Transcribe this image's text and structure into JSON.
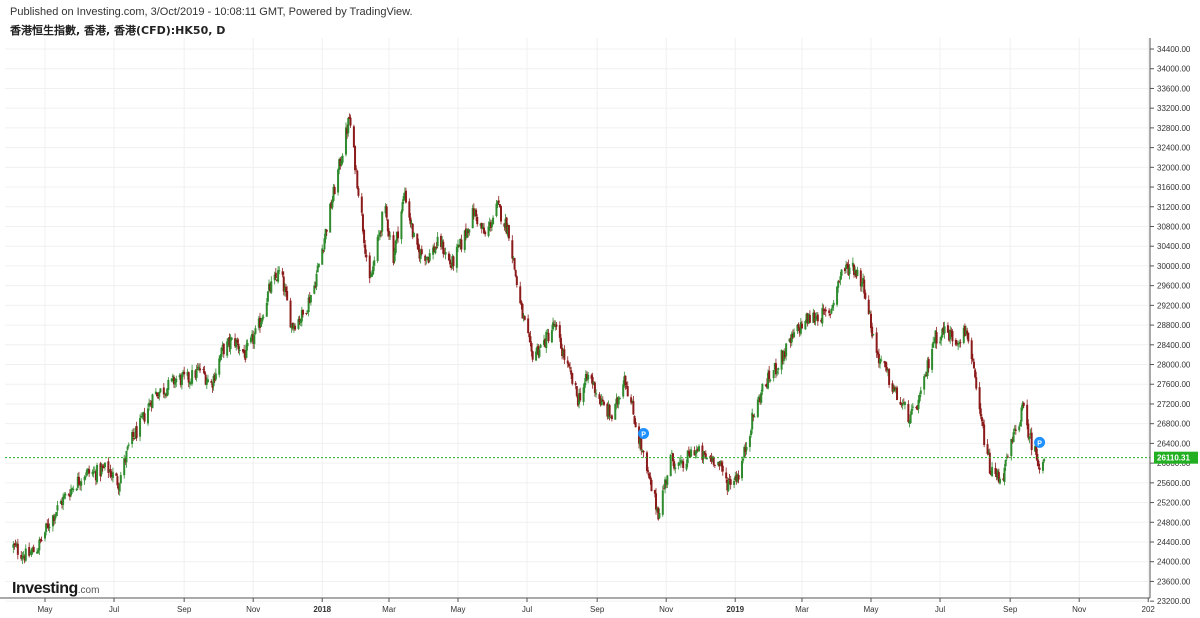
{
  "header": {
    "published": "Published on Investing.com, 3/Oct/2019 - 10:08:11 GMT, Powered by TradingView.",
    "symbol": "香港恒生指數, 香港, 香港(CFD):HK50, D"
  },
  "logo": {
    "name": "Investing",
    "suffix": ".com"
  },
  "colors": {
    "up": "#2e8b2e",
    "down": "#8b1a1a",
    "grid": "#f0f0f0",
    "last_price": "#22b022",
    "marker": "#1e90ff"
  },
  "chart_data": {
    "type": "candlestick",
    "title": "",
    "xlabel": "",
    "ylabel": "",
    "grid": true,
    "ylim": [
      23200,
      34600
    ],
    "y_ticks": [
      "34400.00",
      "34000.00",
      "33600.00",
      "33200.00",
      "32800.00",
      "32400.00",
      "32000.00",
      "31600.00",
      "31200.00",
      "30800.00",
      "30400.00",
      "30000.00",
      "29600.00",
      "29200.00",
      "28800.00",
      "28400.00",
      "28000.00",
      "27600.00",
      "27200.00",
      "26800.00",
      "26400.00",
      "26000.00",
      "25600.00",
      "25200.00",
      "24800.00",
      "24400.00",
      "24000.00",
      "23600.00",
      "23200.00"
    ],
    "x_ticks": [
      "May",
      "Jul",
      "Sep",
      "Nov",
      "2018",
      "Mar",
      "May",
      "Jul",
      "Sep",
      "Nov",
      "2019",
      "Mar",
      "May",
      "Jul",
      "Sep",
      "Nov",
      "202"
    ],
    "last_price": "26110.31",
    "markers": [
      {
        "label": "P",
        "date": "2018-10-12",
        "value": 26600
      },
      {
        "label": "P",
        "date": "2019-09-27",
        "value": 26420
      }
    ],
    "series": [
      {
        "values": [
          {
            "date": "2017-04-03",
            "value": 24300
          },
          {
            "date": "2017-04-15",
            "value": 24100
          },
          {
            "date": "2017-04-25",
            "value": 24300
          },
          {
            "date": "2017-05-05",
            "value": 24800
          },
          {
            "date": "2017-05-15",
            "value": 25200
          },
          {
            "date": "2017-05-25",
            "value": 25500
          },
          {
            "date": "2017-06-05",
            "value": 25800
          },
          {
            "date": "2017-06-15",
            "value": 25800
          },
          {
            "date": "2017-06-25",
            "value": 25900
          },
          {
            "date": "2017-07-05",
            "value": 25600
          },
          {
            "date": "2017-07-15",
            "value": 26400
          },
          {
            "date": "2017-07-25",
            "value": 26800
          },
          {
            "date": "2017-08-05",
            "value": 27400
          },
          {
            "date": "2017-08-15",
            "value": 27500
          },
          {
            "date": "2017-08-25",
            "value": 27700
          },
          {
            "date": "2017-09-05",
            "value": 27700
          },
          {
            "date": "2017-09-15",
            "value": 27900
          },
          {
            "date": "2017-09-25",
            "value": 27600
          },
          {
            "date": "2017-10-05",
            "value": 28300
          },
          {
            "date": "2017-10-15",
            "value": 28500
          },
          {
            "date": "2017-10-25",
            "value": 28200
          },
          {
            "date": "2017-11-05",
            "value": 28700
          },
          {
            "date": "2017-11-15",
            "value": 29500
          },
          {
            "date": "2017-11-25",
            "value": 29900
          },
          {
            "date": "2017-12-05",
            "value": 28800
          },
          {
            "date": "2017-12-15",
            "value": 29000
          },
          {
            "date": "2017-12-25",
            "value": 29600
          },
          {
            "date": "2018-01-05",
            "value": 30800
          },
          {
            "date": "2018-01-15",
            "value": 31900
          },
          {
            "date": "2018-01-25",
            "value": 33000
          },
          {
            "date": "2018-02-05",
            "value": 31000
          },
          {
            "date": "2018-02-12",
            "value": 29600
          },
          {
            "date": "2018-02-25",
            "value": 31200
          },
          {
            "date": "2018-03-05",
            "value": 30200
          },
          {
            "date": "2018-03-15",
            "value": 31500
          },
          {
            "date": "2018-03-25",
            "value": 30300
          },
          {
            "date": "2018-04-05",
            "value": 30200
          },
          {
            "date": "2018-04-15",
            "value": 30500
          },
          {
            "date": "2018-04-25",
            "value": 30000
          },
          {
            "date": "2018-05-05",
            "value": 30500
          },
          {
            "date": "2018-05-15",
            "value": 31100
          },
          {
            "date": "2018-05-25",
            "value": 30600
          },
          {
            "date": "2018-06-05",
            "value": 31200
          },
          {
            "date": "2018-06-15",
            "value": 30700
          },
          {
            "date": "2018-06-25",
            "value": 29200
          },
          {
            "date": "2018-07-05",
            "value": 28200
          },
          {
            "date": "2018-07-15",
            "value": 28400
          },
          {
            "date": "2018-07-25",
            "value": 28800
          },
          {
            "date": "2018-08-05",
            "value": 28000
          },
          {
            "date": "2018-08-15",
            "value": 27300
          },
          {
            "date": "2018-08-25",
            "value": 27800
          },
          {
            "date": "2018-09-05",
            "value": 27200
          },
          {
            "date": "2018-09-15",
            "value": 26900
          },
          {
            "date": "2018-09-25",
            "value": 27800
          },
          {
            "date": "2018-10-05",
            "value": 26800
          },
          {
            "date": "2018-10-15",
            "value": 25800
          },
          {
            "date": "2018-10-25",
            "value": 25000
          },
          {
            "date": "2018-11-05",
            "value": 26100
          },
          {
            "date": "2018-11-15",
            "value": 25900
          },
          {
            "date": "2018-11-25",
            "value": 26300
          },
          {
            "date": "2018-12-05",
            "value": 26100
          },
          {
            "date": "2018-12-15",
            "value": 26100
          },
          {
            "date": "2018-12-25",
            "value": 25600
          },
          {
            "date": "2019-01-05",
            "value": 25800
          },
          {
            "date": "2019-01-15",
            "value": 26800
          },
          {
            "date": "2019-01-25",
            "value": 27500
          },
          {
            "date": "2019-02-05",
            "value": 27900
          },
          {
            "date": "2019-02-15",
            "value": 28300
          },
          {
            "date": "2019-02-25",
            "value": 28700
          },
          {
            "date": "2019-03-05",
            "value": 28900
          },
          {
            "date": "2019-03-15",
            "value": 29000
          },
          {
            "date": "2019-03-25",
            "value": 29000
          },
          {
            "date": "2019-04-05",
            "value": 29900
          },
          {
            "date": "2019-04-15",
            "value": 30000
          },
          {
            "date": "2019-04-25",
            "value": 29600
          },
          {
            "date": "2019-05-05",
            "value": 28300
          },
          {
            "date": "2019-05-15",
            "value": 27800
          },
          {
            "date": "2019-05-25",
            "value": 27300
          },
          {
            "date": "2019-06-05",
            "value": 26900
          },
          {
            "date": "2019-06-15",
            "value": 27400
          },
          {
            "date": "2019-06-25",
            "value": 28500
          },
          {
            "date": "2019-07-05",
            "value": 28700
          },
          {
            "date": "2019-07-15",
            "value": 28500
          },
          {
            "date": "2019-07-25",
            "value": 28700
          },
          {
            "date": "2019-08-05",
            "value": 27000
          },
          {
            "date": "2019-08-15",
            "value": 25800
          },
          {
            "date": "2019-08-25",
            "value": 25700
          },
          {
            "date": "2019-09-05",
            "value": 26600
          },
          {
            "date": "2019-09-12",
            "value": 27100
          },
          {
            "date": "2019-09-20",
            "value": 26400
          },
          {
            "date": "2019-09-27",
            "value": 26000
          },
          {
            "date": "2019-10-02",
            "value": 26110
          }
        ]
      }
    ]
  }
}
